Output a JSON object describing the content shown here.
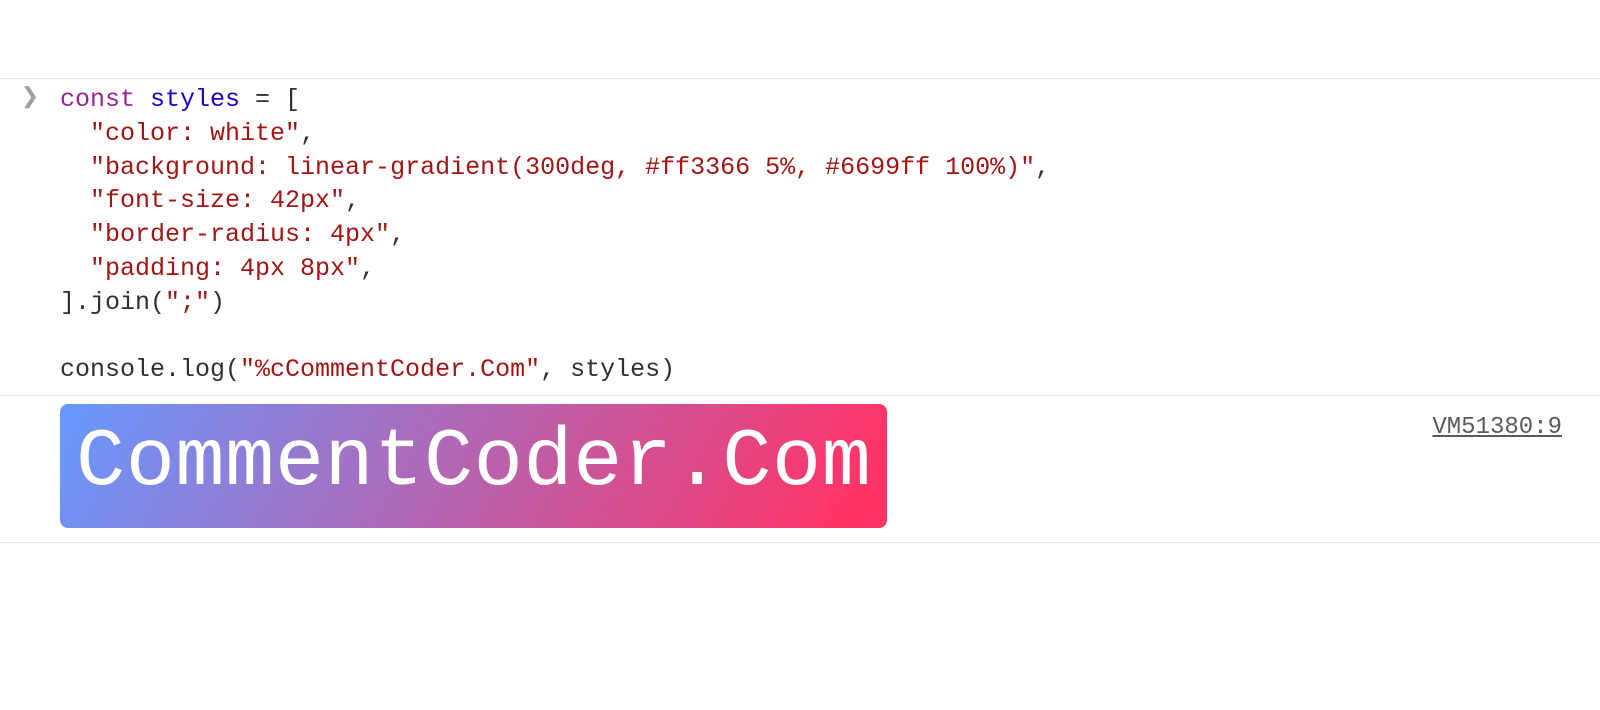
{
  "input": {
    "code_tokens": [
      {
        "t": "const",
        "c": "tok-keyword"
      },
      {
        "t": " ",
        "c": "tok-default"
      },
      {
        "t": "styles",
        "c": "tok-def"
      },
      {
        "t": " = [",
        "c": "tok-default"
      },
      {
        "br": true
      },
      {
        "t": "  ",
        "c": "tok-default"
      },
      {
        "t": "\"color: white\"",
        "c": "tok-string"
      },
      {
        "t": ",",
        "c": "tok-default"
      },
      {
        "br": true
      },
      {
        "t": "  ",
        "c": "tok-default"
      },
      {
        "t": "\"background: linear-gradient(300deg, #ff3366 5%, #6699ff 100%)\"",
        "c": "tok-string"
      },
      {
        "t": ",",
        "c": "tok-default"
      },
      {
        "br": true
      },
      {
        "t": "  ",
        "c": "tok-default"
      },
      {
        "t": "\"font-size: 42px\"",
        "c": "tok-string"
      },
      {
        "t": ",",
        "c": "tok-default"
      },
      {
        "br": true
      },
      {
        "t": "  ",
        "c": "tok-default"
      },
      {
        "t": "\"border-radius: 4px\"",
        "c": "tok-string"
      },
      {
        "t": ",",
        "c": "tok-default"
      },
      {
        "br": true
      },
      {
        "t": "  ",
        "c": "tok-default"
      },
      {
        "t": "\"padding: 4px 8px\"",
        "c": "tok-string"
      },
      {
        "t": ",",
        "c": "tok-default"
      },
      {
        "br": true
      },
      {
        "t": "].join(",
        "c": "tok-default"
      },
      {
        "t": "\";\"",
        "c": "tok-string"
      },
      {
        "t": ")",
        "c": "tok-default"
      },
      {
        "br": true
      },
      {
        "br": true
      },
      {
        "t": "console.log(",
        "c": "tok-default"
      },
      {
        "t": "\"%cCommentCoder.Com\"",
        "c": "tok-string"
      },
      {
        "t": ", styles)",
        "c": "tok-default"
      }
    ]
  },
  "output": {
    "text": "CommentCoder.Com",
    "source": "VM51380:9"
  }
}
